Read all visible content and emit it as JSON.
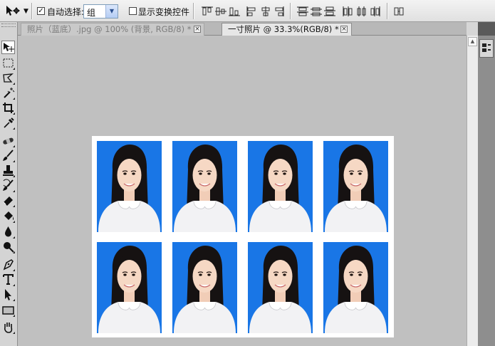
{
  "options_bar": {
    "auto_select_label": "自动选择:",
    "auto_select_checked": "✓",
    "auto_select_value": "组",
    "show_transform_label": "显示变换控件",
    "show_transform_checked": "",
    "icons": [
      "move-tool-icon",
      "align-top-icon",
      "align-vcenter-icon",
      "align-bottom-icon",
      "align-left-icon",
      "align-hcenter-icon",
      "align-right-icon",
      "distribute-top-icon",
      "distribute-vcenter-icon",
      "distribute-bottom-icon",
      "distribute-left-icon",
      "distribute-hcenter-icon",
      "distribute-right-icon",
      "auto-align-icon"
    ]
  },
  "tabs": [
    {
      "title": "照片（蓝底）.jpg @ 100% (背景, RGB/8) *",
      "active": false
    },
    {
      "title": "一寸照片 @ 33.3%(RGB/8) *",
      "active": true
    }
  ],
  "toolbox": {
    "tools": [
      "move-tool",
      "marquee-tool",
      "lasso-tool",
      "magic-wand-tool",
      "crop-tool",
      "eyedropper-tool",
      "healing-brush-tool",
      "brush-tool",
      "clone-stamp-tool",
      "history-brush-tool",
      "eraser-tool",
      "paint-bucket-tool",
      "blur-tool",
      "dodge-tool",
      "pen-tool",
      "type-tool",
      "path-selection-tool",
      "rectangle-tool",
      "hand-tool"
    ]
  },
  "document": {
    "photo_count": 8,
    "columns": 4,
    "rows": 2,
    "photo_background": "#1976e6",
    "sheet_color": "#ffffff",
    "canvas_color": "#c0c0c0"
  }
}
